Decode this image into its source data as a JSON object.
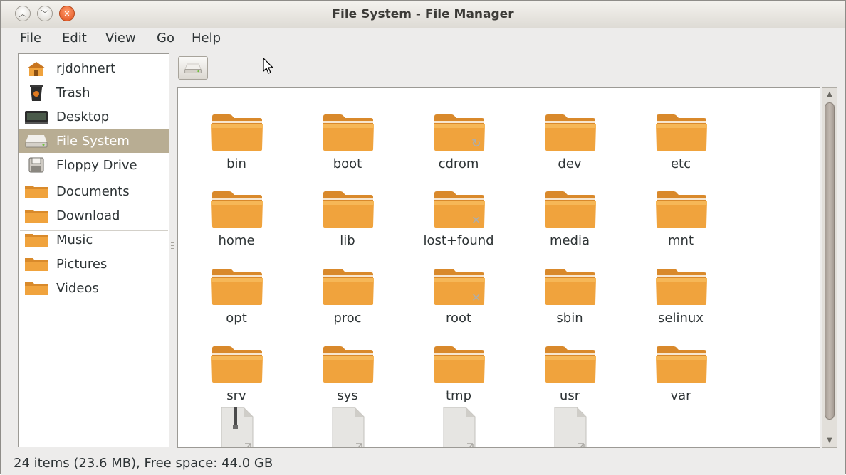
{
  "window": {
    "title": "File System - File Manager"
  },
  "menu": {
    "items": [
      {
        "label": "File",
        "mnemonic": "F",
        "rest": "ile"
      },
      {
        "label": "Edit",
        "mnemonic": "E",
        "rest": "dit"
      },
      {
        "label": "View",
        "mnemonic": "V",
        "rest": "iew"
      },
      {
        "label": "Go",
        "mnemonic": "G",
        "rest": "o"
      },
      {
        "label": "Help",
        "mnemonic": "H",
        "rest": "elp"
      }
    ]
  },
  "sidebar": {
    "items": [
      {
        "label": "rjdohnert",
        "icon": "home-icon"
      },
      {
        "label": "Trash",
        "icon": "trash-icon"
      },
      {
        "label": "Desktop",
        "icon": "desktop-icon"
      },
      {
        "label": "File System",
        "icon": "drive-icon",
        "selected": true
      },
      {
        "label": "Floppy Drive",
        "icon": "floppy-icon"
      },
      {
        "label": "Documents",
        "icon": "folder-icon"
      },
      {
        "label": "Download",
        "icon": "folder-icon"
      },
      {
        "label": "Music",
        "icon": "folder-icon"
      },
      {
        "label": "Pictures",
        "icon": "folder-icon"
      },
      {
        "label": "Videos",
        "icon": "folder-icon"
      }
    ]
  },
  "files": [
    {
      "name": "bin",
      "type": "folder"
    },
    {
      "name": "boot",
      "type": "folder"
    },
    {
      "name": "cdrom",
      "type": "folder",
      "emblem": "symlink"
    },
    {
      "name": "dev",
      "type": "folder"
    },
    {
      "name": "etc",
      "type": "folder"
    },
    {
      "name": "home",
      "type": "folder"
    },
    {
      "name": "lib",
      "type": "folder"
    },
    {
      "name": "lost+found",
      "type": "folder",
      "emblem": "no-access"
    },
    {
      "name": "media",
      "type": "folder"
    },
    {
      "name": "mnt",
      "type": "folder"
    },
    {
      "name": "opt",
      "type": "folder"
    },
    {
      "name": "proc",
      "type": "folder"
    },
    {
      "name": "root",
      "type": "folder",
      "emblem": "no-access"
    },
    {
      "name": "sbin",
      "type": "folder"
    },
    {
      "name": "selinux",
      "type": "folder"
    },
    {
      "name": "srv",
      "type": "folder"
    },
    {
      "name": "sys",
      "type": "folder"
    },
    {
      "name": "tmp",
      "type": "folder"
    },
    {
      "name": "usr",
      "type": "folder"
    },
    {
      "name": "var",
      "type": "folder"
    },
    {
      "name": "",
      "type": "archive-link"
    },
    {
      "name": "",
      "type": "file-link"
    },
    {
      "name": "",
      "type": "file-link"
    },
    {
      "name": "",
      "type": "file-link"
    }
  ],
  "status": {
    "text": "24 items (23.6 MB), Free space: 44.0 GB"
  },
  "colors": {
    "folder": "#f0a33d",
    "selection": "#b8ad93",
    "close_button": "#e0501d"
  }
}
